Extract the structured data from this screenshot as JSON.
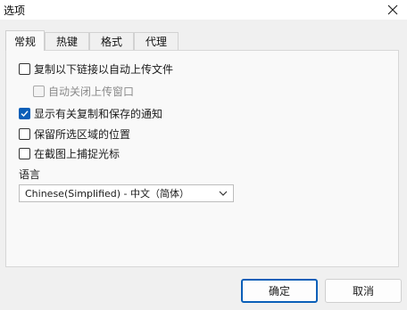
{
  "window": {
    "title": "选项"
  },
  "tabs": [
    {
      "label": "常规",
      "active": true
    },
    {
      "label": "热键",
      "active": false
    },
    {
      "label": "格式",
      "active": false
    },
    {
      "label": "代理",
      "active": false
    }
  ],
  "options": [
    {
      "label": "复制以下链接以自动上传文件",
      "checked": false,
      "disabled": false
    },
    {
      "label": "自动关闭上传窗口",
      "checked": false,
      "disabled": true
    },
    {
      "label": "显示有关复制和保存的通知",
      "checked": true,
      "disabled": false
    },
    {
      "label": "保留所选区域的位置",
      "checked": false,
      "disabled": false
    },
    {
      "label": "在截图上捕捉光标",
      "checked": false,
      "disabled": false
    }
  ],
  "language": {
    "label": "语言",
    "selected": "Chinese(Simplified) - 中文（简体）"
  },
  "buttons": {
    "ok": "确定",
    "cancel": "取消"
  },
  "colors": {
    "accent": "#0a5fb8",
    "background": "#f0f0f0",
    "panel": "#f9f9f9"
  }
}
